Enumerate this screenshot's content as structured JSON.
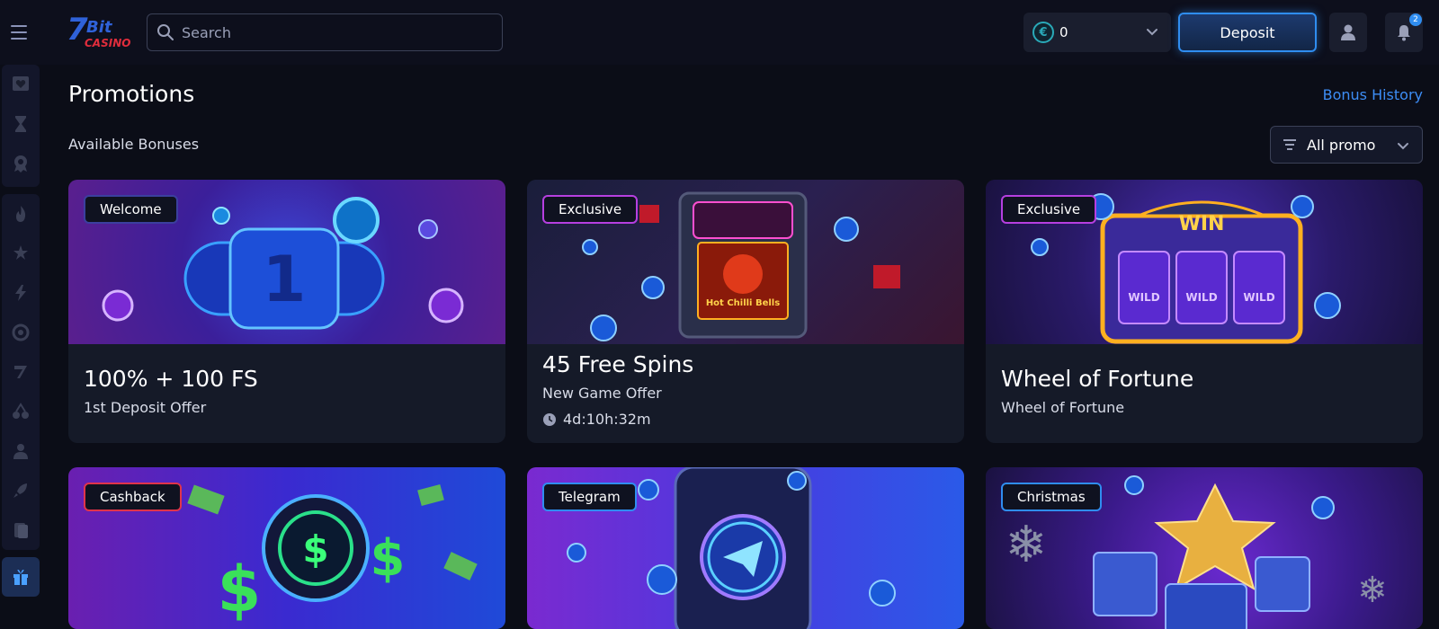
{
  "header": {
    "logo": {
      "number": "7",
      "text_top": "Bit",
      "text_bottom": "CASINO"
    },
    "search_placeholder": "Search",
    "balance": {
      "currency_symbol": "€",
      "amount": "0"
    },
    "deposit_label": "Deposit",
    "notifications_count": "2"
  },
  "sidebar": {
    "top_items": [
      "heart-icon",
      "hourglass-icon",
      "award-icon"
    ],
    "category_items": [
      "fire-icon",
      "stars-icon",
      "bolt-icon",
      "target-icon",
      "slots-icon",
      "cherries-icon",
      "dealer-icon",
      "rocket-icon",
      "cards-icon"
    ],
    "active_item": "gift-icon"
  },
  "main": {
    "title": "Promotions",
    "bonus_history": "Bonus History",
    "subtitle": "Available Bonuses",
    "filter_label": "All promo"
  },
  "cards": [
    {
      "badge": "Welcome",
      "badge_color": "#3b3f9e",
      "title": "100% + 100 FS",
      "subtitle": "1st Deposit Offer"
    },
    {
      "badge": "Exclusive",
      "badge_color": "#b63fe0",
      "title": "45 Free Spins",
      "subtitle": "New Game Offer",
      "timer": "4d:10h:32m"
    },
    {
      "badge": "Exclusive",
      "badge_color": "#b63fe0",
      "title": "Wheel of Fortune",
      "subtitle": "Wheel of Fortune"
    },
    {
      "badge": "Cashback",
      "badge_color": "#e0344a"
    },
    {
      "badge": "Telegram",
      "badge_color": "#2f8df0"
    },
    {
      "badge": "Christmas",
      "badge_color": "#2f8df0"
    }
  ],
  "colors": {
    "background": "#0b0d17",
    "header": "#0d0f1c",
    "card": "#151a28",
    "accent": "#2f8df0",
    "link": "#3d8df5"
  }
}
